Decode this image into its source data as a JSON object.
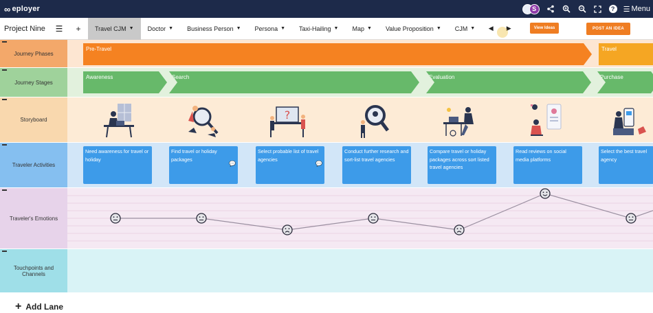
{
  "header": {
    "logo_text": "eployer",
    "logo_glyph": "∞",
    "avatars": [
      {
        "initial": ""
      },
      {
        "initial": "S"
      }
    ],
    "menu_label": "Menu"
  },
  "toolbar": {
    "project_name": "Project Nine",
    "tabs": [
      {
        "label": "Travel CJM",
        "active": true
      },
      {
        "label": "Doctor"
      },
      {
        "label": "Business Person"
      },
      {
        "label": "Persona"
      },
      {
        "label": "Taxi-Hailing"
      },
      {
        "label": "Map"
      },
      {
        "label": "Value Proposition"
      },
      {
        "label": "CJM"
      }
    ],
    "view_ideas_label": "View Ideas",
    "post_idea_label": "POST AN IDEA"
  },
  "lanes": {
    "phases": {
      "label": "Journey Phases",
      "items": [
        "Pre-Travel",
        "Travel"
      ]
    },
    "stages": {
      "label": "Journey Stages",
      "items": [
        "Awareness",
        "Search",
        "Evaluation",
        "Purchase"
      ]
    },
    "storyboard": {
      "label": "Storyboard"
    },
    "activities": {
      "label": "Traveler Activities",
      "cards": [
        "Need awareness for travel or holiday",
        "Find travel or holiday packages",
        "Select probable list of travel agencies",
        "Conduct further research and sort-list travel agencies",
        "Compare travel or holiday packages across sort listed travel agencies",
        "Read reviews on social media platforms",
        "Select the best travel agency"
      ]
    },
    "emotions": {
      "label": "Traveler's Emotions",
      "levels": [
        "neutral",
        "neutral",
        "sad",
        "neutral",
        "sad",
        "happy",
        "neutral"
      ]
    },
    "touchpoints": {
      "label": "Touchpoints and Channels"
    }
  },
  "add_lane_label": "Add Lane",
  "colors": {
    "header_bg": "#1d2a4a",
    "accent_orange": "#ef7d22",
    "phase_orange": "#f58221",
    "stage_green": "#67b96a",
    "card_blue": "#3d9be9"
  }
}
